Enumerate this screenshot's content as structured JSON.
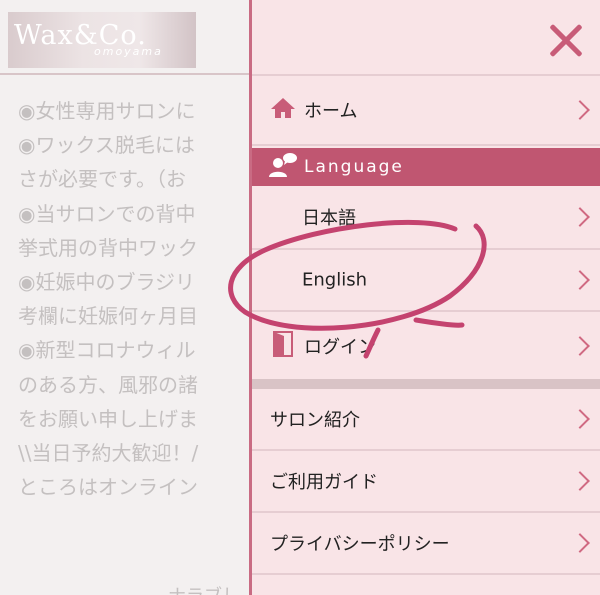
{
  "logo": {
    "main": "Wax&Co.",
    "sub": "omoyama"
  },
  "background_text": [
    "◉女性専用サロンに",
    "◉ワックス脱毛には",
    "さが必要です。（お",
    "◉当サロンでの背中",
    "挙式用の背中ワック",
    "◉妊娠中のブラジリ",
    "考欄に妊娠何ヶ月目",
    "◉新型コロナウィル",
    "のある方、風邪の諸",
    "をお願い申し上げま",
    "\\\\当日予約大歓迎！/",
    "ところはオンライン"
  ],
  "background_bottom": "ナラブし",
  "menu": {
    "home": "ホーム",
    "language_header": "Language",
    "japanese": "日本語",
    "english": "English",
    "login": "ログイン",
    "salon": "サロン紹介",
    "guide": "ご利用ガイド",
    "privacy": "プライバシーポリシー"
  },
  "icons": {
    "close": "close-icon",
    "home": "home-icon",
    "language": "people-chat-icon",
    "login": "door-icon",
    "chevron": "chevron-right-icon"
  },
  "colors": {
    "accent": "#c05671",
    "drawer_bg": "#f9e4e7",
    "annotation": "#c4436f"
  }
}
